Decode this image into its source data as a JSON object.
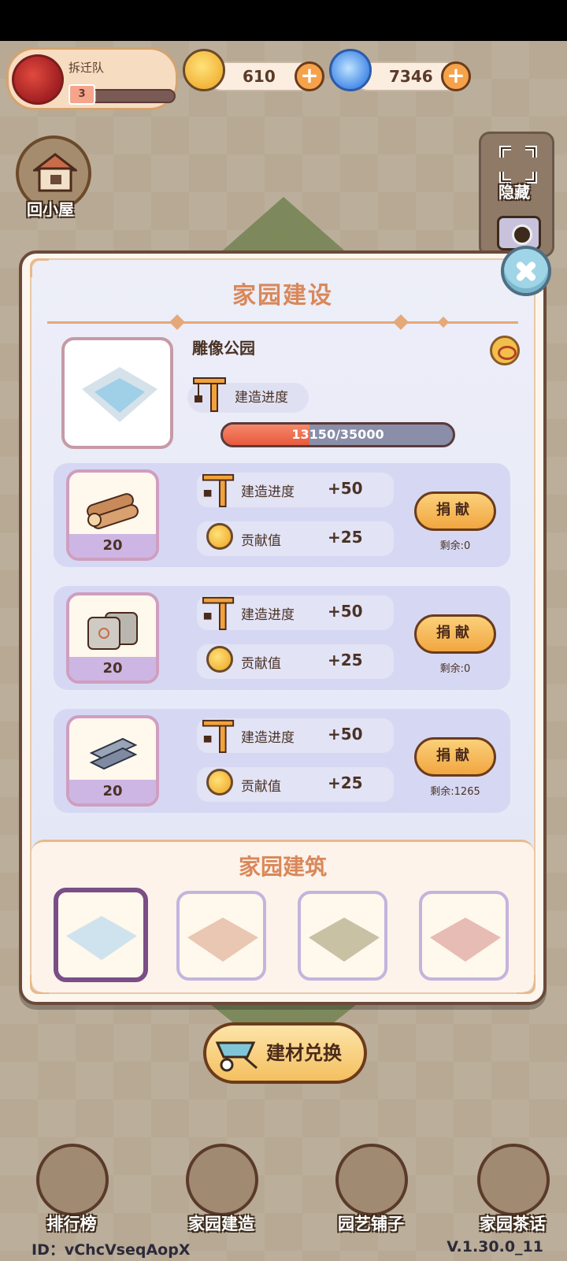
{
  "player": {
    "name": "拆迁队",
    "level": "3",
    "level_progress": 0.08
  },
  "currencies": [
    {
      "icon": "snail-coin-icon",
      "value": "610"
    },
    {
      "icon": "swirl-gem-icon",
      "value": "7346"
    }
  ],
  "side": {
    "home_label": "回小屋",
    "hide_label": "隐藏"
  },
  "modal": {
    "title": "家园建设",
    "building": {
      "name": "雕像公园",
      "progress_label": "建造进度",
      "progress_text": "13150/35000",
      "progress_current": 13150,
      "progress_total": 35000
    },
    "materials": [
      {
        "name": "wood-logs",
        "count": "20",
        "progress_label": "建造进度",
        "progress_value": "+50",
        "contrib_label": "贡献值",
        "contrib_value": "+25",
        "button": "捐献",
        "remaining": "剩余:0"
      },
      {
        "name": "cement-bags",
        "count": "20",
        "progress_label": "建造进度",
        "progress_value": "+50",
        "contrib_label": "贡献值",
        "contrib_value": "+25",
        "button": "捐献",
        "remaining": "剩余:0"
      },
      {
        "name": "steel-beams",
        "count": "20",
        "progress_label": "建造进度",
        "progress_value": "+50",
        "contrib_label": "贡献值",
        "contrib_value": "+25",
        "button": "捐献",
        "remaining": "剩余:1265"
      }
    ],
    "buildings_section_title": "家园建筑",
    "buildings": [
      {
        "name": "statue-park",
        "selected": true,
        "color": "#cfe3ee"
      },
      {
        "name": "cherry-blossom-garden",
        "selected": false,
        "color": "#e9c7b2"
      },
      {
        "name": "villa-lot",
        "selected": false,
        "color": "#c9c1a4"
      },
      {
        "name": "pink-cottages",
        "selected": false,
        "color": "#e6bcb4"
      }
    ]
  },
  "exchange_button": "建材兑换",
  "nav": [
    {
      "icon": "leaderboard-icon",
      "label": "排行榜"
    },
    {
      "icon": "brick-trowel-icon",
      "label": "家园建造"
    },
    {
      "icon": "flower-basket-icon",
      "label": "园艺铺子"
    },
    {
      "icon": "chat-bubbles-icon",
      "label": "家园茶话"
    }
  ],
  "footer": {
    "id_text": "ID：vChcVseqAopX",
    "version": "V.1.30.0_11"
  },
  "colors": {
    "accent_orange": "#d9885a",
    "progress_fill": "#e8593d",
    "button_gold": "#f1a640"
  }
}
